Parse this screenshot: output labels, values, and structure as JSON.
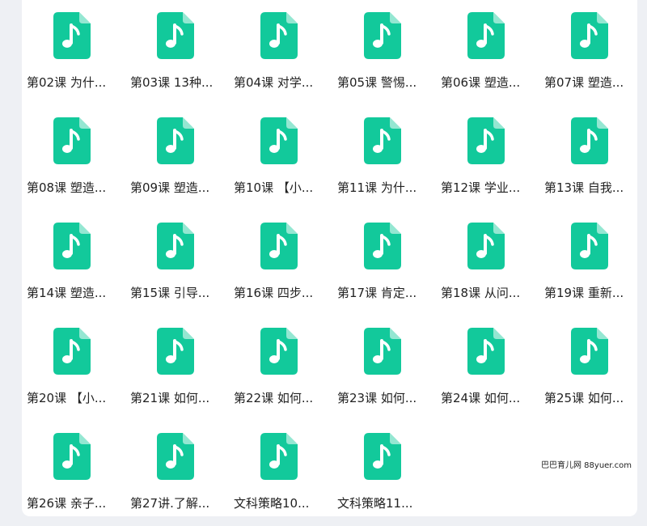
{
  "files": [
    {
      "name": "第02课 为什..."
    },
    {
      "name": "第03课 13种..."
    },
    {
      "name": "第04课 对学..."
    },
    {
      "name": "第05课 警惕..."
    },
    {
      "name": "第06课 塑造..."
    },
    {
      "name": "第07课 塑造..."
    },
    {
      "name": "第08课 塑造..."
    },
    {
      "name": "第09课 塑造..."
    },
    {
      "name": "第10课 【小..."
    },
    {
      "name": "第11课 为什..."
    },
    {
      "name": "第12课 学业..."
    },
    {
      "name": "第13课 自我..."
    },
    {
      "name": "第14课 塑造..."
    },
    {
      "name": "第15课 引导..."
    },
    {
      "name": "第16课 四步..."
    },
    {
      "name": "第17课 肯定..."
    },
    {
      "name": "第18课 从问..."
    },
    {
      "name": "第19课 重新..."
    },
    {
      "name": "第20课 【小..."
    },
    {
      "name": "第21课 如何..."
    },
    {
      "name": "第22课 如何..."
    },
    {
      "name": "第23课 如何..."
    },
    {
      "name": "第24课 如何..."
    },
    {
      "name": "第25课 如何..."
    },
    {
      "name": "第26课 亲子..."
    },
    {
      "name": "第27讲.了解..."
    },
    {
      "name": "文科策略10..."
    },
    {
      "name": "文科策略11..."
    }
  ],
  "icon": "music-file-icon",
  "colors": {
    "icon": "#12c99b",
    "background": "#ffffff",
    "page": "#eef0f4"
  },
  "watermark": "巴巴育儿网 88yuer.com"
}
